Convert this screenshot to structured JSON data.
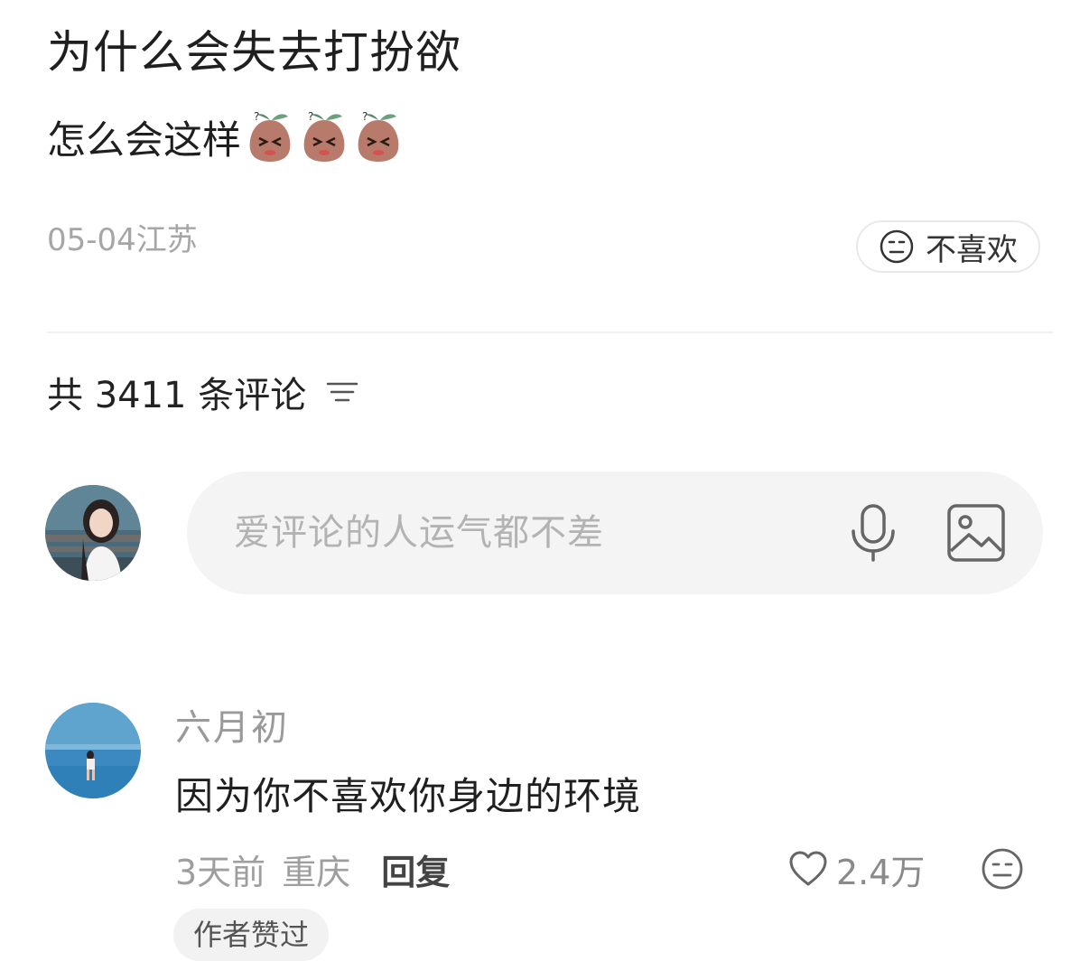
{
  "post": {
    "title": "为什么会失去打扮欲",
    "body": "怎么会这样",
    "emojis": [
      "sweating-peach-emoji",
      "sweating-peach-emoji",
      "sweating-peach-emoji"
    ],
    "meta": "05-04江苏",
    "dislike_label": "不喜欢"
  },
  "comments_header": {
    "count_label": "共 3411 条评论"
  },
  "comment_input": {
    "placeholder": "爱评论的人运气都不差"
  },
  "comments": [
    {
      "author": "六月初",
      "text": "因为你不喜欢你身边的环境",
      "time": "3天前",
      "location": "重庆",
      "reply_label": "回复",
      "likes": "2.4万",
      "badge": "作者赞过"
    }
  ],
  "colors": {
    "text_primary": "#1f1f1f",
    "text_secondary": "#a6a6a6",
    "input_bg": "#f4f4f4",
    "divider": "#f0f0f0"
  }
}
